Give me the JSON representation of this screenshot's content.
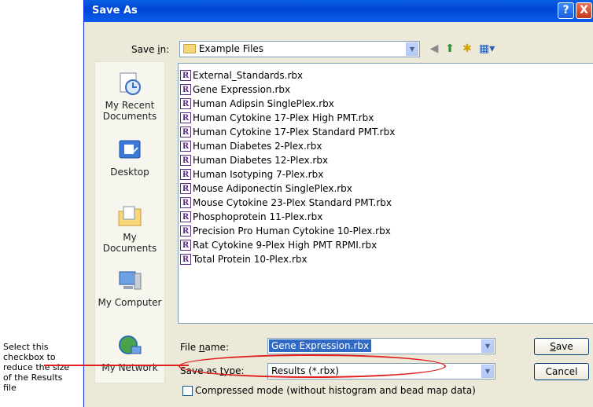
{
  "annotation": {
    "lines": [
      "Select this",
      "checkbox to",
      "reduce the size",
      "of the Results",
      "file"
    ]
  },
  "dialog": {
    "title": "Save As",
    "help_label": "?",
    "close_label": "X"
  },
  "save_in": {
    "label_pre": "Save ",
    "label_u": "i",
    "label_post": "n:",
    "value": "Example Files"
  },
  "toolbar": {
    "icons": [
      "back-icon",
      "up-folder-icon",
      "new-folder-icon",
      "views-menu-icon"
    ]
  },
  "places": [
    {
      "label": "My Recent Documents",
      "icon": "recent-documents-icon"
    },
    {
      "label": "Desktop",
      "icon": "desktop-icon"
    },
    {
      "label": "My Documents",
      "icon": "my-documents-icon"
    },
    {
      "label": "My Computer",
      "icon": "my-computer-icon"
    },
    {
      "label": "My Network",
      "icon": "my-network-icon"
    }
  ],
  "files": [
    "External_Standards.rbx",
    "Gene Expression.rbx",
    "Human Adipsin SinglePlex.rbx",
    "Human Cytokine 17-Plex High PMT.rbx",
    "Human Cytokine 17-Plex Standard PMT.rbx",
    "Human Diabetes 2-Plex.rbx",
    "Human Diabetes 12-Plex.rbx",
    "Human Isotyping 7-Plex.rbx",
    "Mouse Adiponectin SinglePlex.rbx",
    "Mouse Cytokine 23-Plex Standard PMT.rbx",
    "Phosphoprotein 11-Plex.rbx",
    "Precision Pro Human Cytokine 10-Plex.rbx",
    "Rat Cytokine 9-Plex High PMT RPMI.rbx",
    "Total Protein 10-Plex.rbx"
  ],
  "file_icon_letter": "R",
  "file_name": {
    "label_pre": "File ",
    "label_u": "n",
    "label_post": "ame:",
    "value": "Gene Expression.rbx"
  },
  "save_type": {
    "label_pre": "Save as ",
    "label_u": "t",
    "label_post": "ype:",
    "value": "Results (*.rbx)"
  },
  "buttons": {
    "save_u": "S",
    "save_rest": "ave",
    "cancel": "Cancel"
  },
  "compressed": {
    "label": "Compressed mode (without histogram and bead map data)",
    "checked": false
  },
  "colors": {
    "titlebar": "#0046d5",
    "dialog_bg": "#ece9d8",
    "callout": "#e02020",
    "selection": "#316ac5"
  }
}
